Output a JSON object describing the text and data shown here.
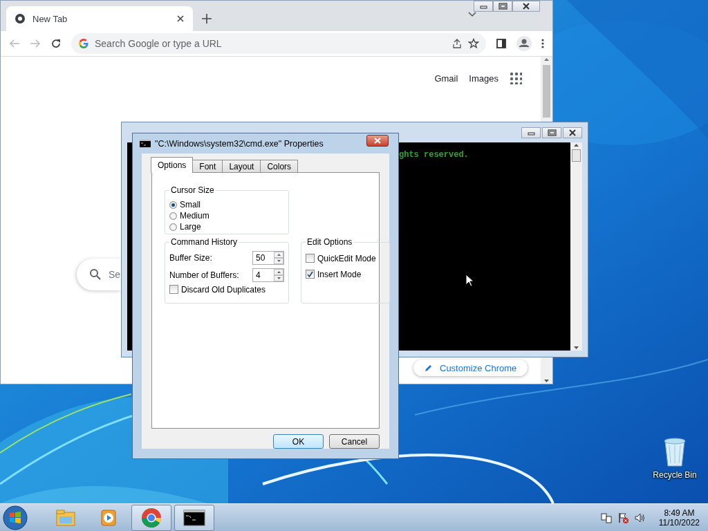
{
  "browser": {
    "tabs": [
      {
        "title": "New Tab",
        "selected": true
      }
    ],
    "address_bar": {
      "placeholder": "Search Google or type a URL"
    },
    "header_links": [
      "Gmail",
      "Images"
    ],
    "search_box": {
      "placeholder": "Se"
    },
    "customize_button": "Customize Chrome"
  },
  "console": {
    "lines": [
      "ghts reserved."
    ]
  },
  "dialog": {
    "title": "\"C:\\Windows\\system32\\cmd.exe\" Properties",
    "tabs": [
      {
        "label": "Options",
        "selected": true
      },
      {
        "label": "Font",
        "selected": false
      },
      {
        "label": "Layout",
        "selected": false
      },
      {
        "label": "Colors",
        "selected": false
      }
    ],
    "cursor_size": {
      "label": "Cursor Size",
      "options": [
        {
          "label": "Small",
          "selected": true
        },
        {
          "label": "Medium",
          "selected": false
        },
        {
          "label": "Large",
          "selected": false
        }
      ]
    },
    "command_history": {
      "label": "Command History",
      "fields": [
        {
          "label": "Buffer Size:",
          "value": "50"
        },
        {
          "label": "Number of Buffers:",
          "value": "4"
        }
      ],
      "checkboxes": [
        {
          "label": "Discard Old Duplicates",
          "checked": false
        }
      ]
    },
    "edit_options": {
      "label": "Edit Options",
      "checkboxes": [
        {
          "label": "QuickEdit Mode",
          "checked": false
        },
        {
          "label": "Insert Mode",
          "checked": true
        }
      ]
    },
    "buttons": [
      {
        "label": "OK",
        "default": true
      },
      {
        "label": "Cancel",
        "default": false
      }
    ]
  },
  "desktop_icons": [
    {
      "label": "Recycle Bin"
    }
  ],
  "taskbar": {
    "apps": [
      {
        "kind": "explorer",
        "active": false
      },
      {
        "kind": "media",
        "active": false
      },
      {
        "kind": "chrome",
        "active": true
      },
      {
        "kind": "console",
        "active": true
      }
    ],
    "clock": {
      "time": "8:49 AM",
      "date": "11/10/2022"
    }
  }
}
